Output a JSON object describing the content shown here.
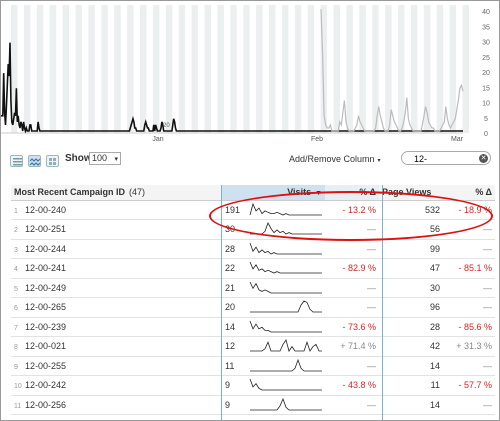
{
  "chart_data": {
    "type": "line",
    "x_labels": [
      "Jan",
      "Feb",
      "Mar"
    ],
    "y_ticks": [
      0,
      5,
      10,
      15,
      20,
      25,
      30,
      35,
      40
    ],
    "ylim": [
      0,
      42
    ],
    "inline_label": "20",
    "series": [
      {
        "color": "#111111",
        "values": [
          5,
          5,
          5,
          19,
          6,
          2,
          8,
          15,
          22,
          18,
          29,
          10,
          3,
          2,
          4,
          6,
          5,
          14,
          3,
          5,
          2,
          1,
          3,
          2,
          0,
          3,
          1,
          0,
          1,
          0,
          0,
          0,
          2,
          2,
          0,
          0,
          0,
          0,
          0,
          0,
          0,
          3,
          1,
          0,
          0,
          0,
          0,
          0,
          0,
          0,
          0,
          0,
          0,
          0,
          0,
          0,
          0,
          0,
          0,
          0,
          0,
          0,
          0,
          0,
          0,
          0,
          0,
          0,
          0,
          0,
          0,
          0,
          0,
          0,
          0,
          0,
          0,
          0,
          0,
          0,
          0,
          0,
          0,
          0,
          0,
          0,
          0,
          0,
          0,
          0,
          0,
          0,
          0,
          0,
          0,
          0,
          0,
          0,
          0,
          0,
          0,
          0,
          0,
          0,
          0,
          0,
          0,
          0,
          0,
          0,
          0,
          0,
          0,
          0,
          0,
          0,
          0,
          0,
          0,
          0,
          0,
          0,
          0,
          0,
          0,
          0,
          0,
          0,
          0,
          0,
          0,
          0,
          0,
          0,
          0,
          0,
          0,
          0,
          0,
          0,
          0,
          0,
          0,
          1,
          2,
          3,
          4,
          3,
          1,
          1,
          0,
          0,
          0,
          0,
          0,
          0,
          0,
          0,
          0,
          2,
          3,
          2,
          1,
          1,
          0,
          0,
          0,
          0,
          0,
          2,
          0,
          2,
          1,
          0,
          0,
          0,
          0,
          1,
          3,
          2,
          0,
          0,
          0,
          0,
          0,
          0,
          0,
          0,
          0,
          0,
          2,
          4,
          3,
          1,
          0,
          0,
          0,
          0,
          0,
          0,
          0,
          0,
          0,
          0,
          0,
          0,
          0,
          0,
          0,
          0,
          0,
          0,
          0,
          0,
          0,
          0,
          0,
          0,
          0,
          0,
          0,
          0,
          0,
          0,
          0,
          0,
          0,
          0,
          0,
          0,
          0,
          0,
          0,
          0,
          0,
          0,
          0,
          0,
          0,
          0,
          0,
          0,
          0,
          0,
          0,
          0,
          0,
          0,
          0,
          0,
          0,
          0,
          0,
          0,
          0,
          0,
          0,
          0,
          0,
          0,
          0,
          0,
          0,
          0,
          0,
          0,
          0,
          0,
          0,
          0,
          0,
          0,
          0,
          0,
          0,
          0,
          0,
          0,
          0,
          0,
          0,
          0,
          0,
          0,
          0,
          0,
          0,
          0,
          0,
          0,
          0,
          0,
          0,
          0,
          0,
          0,
          0,
          0,
          0,
          0,
          0,
          0,
          0,
          0,
          0,
          0,
          0,
          0,
          0,
          0,
          0,
          0,
          0,
          0,
          0,
          0,
          0,
          0,
          0,
          0,
          0,
          0,
          0,
          0,
          0,
          0,
          0,
          0,
          0,
          0,
          0,
          0,
          0,
          0,
          0,
          0,
          0,
          0,
          0,
          0,
          0,
          0,
          0,
          0,
          0,
          0,
          0,
          0,
          0,
          0,
          0,
          0,
          0,
          0,
          0,
          0,
          0,
          0,
          0,
          0,
          0,
          0,
          0,
          0,
          0,
          0,
          0,
          0,
          0,
          0,
          0,
          0,
          0,
          0,
          0,
          0,
          0,
          0,
          0,
          0,
          0,
          0,
          0,
          0,
          0,
          0,
          0,
          0,
          0,
          0,
          0,
          0,
          0,
          0,
          0,
          0,
          0,
          0,
          0,
          0,
          0,
          0,
          0,
          0,
          0,
          0,
          0,
          0,
          0,
          0,
          0,
          0,
          0,
          0,
          0,
          0,
          0,
          0,
          0,
          0,
          0,
          0,
          0,
          0,
          0,
          0,
          0,
          0,
          0,
          0,
          0,
          0,
          0,
          0,
          0,
          0,
          0,
          0,
          0,
          0,
          0,
          0,
          0,
          0,
          0,
          0,
          0,
          0,
          0,
          0,
          0,
          0,
          0,
          0,
          0,
          0,
          0,
          0,
          0,
          0,
          0,
          0,
          0,
          0,
          0,
          0,
          0,
          0,
          0,
          0,
          0,
          0,
          0,
          0,
          0,
          0,
          0,
          0,
          0,
          0,
          0,
          0,
          0,
          0,
          0,
          0,
          0,
          0,
          0,
          0,
          0,
          0,
          0,
          0,
          0,
          0,
          0,
          0,
          0,
          0,
          0,
          0,
          0,
          0,
          0,
          0,
          0,
          0,
          0,
          0,
          0,
          0
        ]
      },
      {
        "color": "#bbbbbb",
        "values": [
          40,
          25,
          5,
          2,
          1,
          1,
          2,
          0,
          0,
          0,
          0,
          0,
          3,
          2,
          6,
          10,
          3,
          1,
          0,
          0,
          0,
          0,
          1,
          2,
          5,
          3,
          2,
          1,
          0,
          0,
          0,
          0,
          0,
          0,
          0,
          1,
          5,
          8,
          5,
          3,
          1,
          0,
          0,
          0,
          2,
          7,
          5,
          3,
          2,
          1,
          0,
          0,
          1,
          3,
          6,
          11,
          4,
          2,
          1,
          0,
          0,
          0,
          0,
          0,
          0,
          2,
          5,
          8,
          6,
          3,
          2,
          1,
          1,
          0,
          0,
          0,
          0,
          1,
          2,
          3,
          8,
          4,
          2,
          1,
          2,
          3,
          4,
          7,
          10,
          14,
          15,
          13
        ]
      }
    ]
  },
  "toolbar": {
    "show_label": "Show",
    "show_value": "100",
    "add_remove_label": "Add/Remove Column",
    "search_value": "12-"
  },
  "table": {
    "headers": {
      "id": "Most Recent Campaign ID",
      "count": "(47)",
      "visits": "Visits",
      "visits_pct": "% Δ",
      "pageviews": "Page Views",
      "pv_pct": "% Δ"
    },
    "rows": [
      {
        "idx": "1",
        "id": "12-00-240",
        "visits": "191",
        "vpct": "- 13.2 %",
        "vpct_type": "neg",
        "pv": "532",
        "pvpct": "- 18.9 %",
        "pvpct_type": "neg",
        "spark": [
          0,
          8,
          3,
          5,
          1,
          3,
          2,
          1,
          1,
          2,
          1,
          0,
          1,
          0,
          0,
          0,
          0,
          0,
          0,
          0,
          0,
          0,
          0,
          0,
          0
        ]
      },
      {
        "idx": "2",
        "id": "12-00-251",
        "visits": "30",
        "vpct": "—",
        "vpct_type": "dash",
        "pv": "56",
        "pvpct": "—",
        "pvpct_type": "dash",
        "spark": [
          0,
          0,
          0,
          0,
          0,
          2,
          8,
          4,
          1,
          3,
          1,
          2,
          0,
          1,
          0,
          0,
          0,
          0,
          0,
          0,
          0,
          0,
          0,
          0,
          0
        ]
      },
      {
        "idx": "3",
        "id": "12-00-244",
        "visits": "28",
        "vpct": "—",
        "vpct_type": "dash",
        "pv": "99",
        "pvpct": "—",
        "pvpct_type": "dash",
        "spark": [
          8,
          2,
          5,
          1,
          3,
          1,
          2,
          0,
          1,
          0,
          0,
          0,
          0,
          0,
          0,
          0,
          0,
          0,
          0,
          0,
          0,
          0,
          0,
          0,
          0
        ]
      },
      {
        "idx": "4",
        "id": "12-00-241",
        "visits": "22",
        "vpct": "- 82.9 %",
        "vpct_type": "neg",
        "pv": "47",
        "pvpct": "- 85.1 %",
        "pvpct_type": "neg",
        "spark": [
          8,
          3,
          6,
          2,
          3,
          1,
          2,
          1,
          0,
          1,
          0,
          0,
          0,
          0,
          0,
          0,
          0,
          0,
          0,
          0,
          0,
          0,
          0,
          0,
          0
        ]
      },
      {
        "idx": "5",
        "id": "12-00-249",
        "visits": "21",
        "vpct": "—",
        "vpct_type": "dash",
        "pv": "30",
        "pvpct": "—",
        "pvpct_type": "dash",
        "spark": [
          7,
          3,
          6,
          2,
          1,
          2,
          1,
          0,
          0,
          0,
          0,
          0,
          0,
          0,
          0,
          0,
          0,
          0,
          0,
          0,
          0,
          0,
          0,
          0,
          0
        ]
      },
      {
        "idx": "6",
        "id": "12-00-265",
        "visits": "20",
        "vpct": "—",
        "vpct_type": "dash",
        "pv": "96",
        "pvpct": "—",
        "pvpct_type": "dash",
        "spark": [
          0,
          0,
          0,
          0,
          0,
          0,
          0,
          0,
          0,
          0,
          0,
          0,
          0,
          0,
          0,
          0,
          0,
          5,
          8,
          7,
          2,
          0,
          0,
          0,
          0
        ]
      },
      {
        "idx": "7",
        "id": "12-00-239",
        "visits": "14",
        "vpct": "- 73.6 %",
        "vpct_type": "neg",
        "pv": "28",
        "pvpct": "- 85.6 %",
        "pvpct_type": "neg",
        "spark": [
          7,
          2,
          5,
          2,
          3,
          1,
          1,
          0,
          0,
          0,
          0,
          0,
          0,
          0,
          0,
          0,
          0,
          0,
          0,
          0,
          0,
          0,
          0,
          0,
          0
        ]
      },
      {
        "idx": "8",
        "id": "12-00-021",
        "visits": "12",
        "vpct": "+ 71.4 %",
        "vpct_type": "pos",
        "pv": "42",
        "pvpct": "+ 31.3 %",
        "pvpct_type": "pos",
        "spark": [
          0,
          0,
          0,
          0,
          0,
          1,
          4,
          0,
          0,
          0,
          0,
          3,
          5,
          0,
          2,
          0,
          0,
          0,
          0,
          4,
          0,
          2,
          3,
          0,
          0
        ]
      },
      {
        "idx": "9",
        "id": "12-00-255",
        "visits": "11",
        "vpct": "—",
        "vpct_type": "dash",
        "pv": "14",
        "pvpct": "—",
        "pvpct_type": "dash",
        "spark": [
          0,
          0,
          0,
          0,
          0,
          0,
          0,
          0,
          0,
          0,
          0,
          0,
          0,
          0,
          0,
          2,
          8,
          2,
          0,
          0,
          0,
          0,
          0,
          0,
          0
        ]
      },
      {
        "idx": "10",
        "id": "12-00-242",
        "visits": "9",
        "vpct": "- 43.8 %",
        "vpct_type": "neg",
        "pv": "11",
        "pvpct": "- 57.7 %",
        "pvpct_type": "neg",
        "spark": [
          7,
          2,
          4,
          1,
          0,
          0,
          0,
          0,
          0,
          0,
          0,
          0,
          0,
          0,
          0,
          0,
          0,
          0,
          0,
          0,
          0,
          0,
          0,
          0,
          0
        ]
      },
      {
        "idx": "11",
        "id": "12-00-256",
        "visits": "9",
        "vpct": "—",
        "vpct_type": "dash",
        "pv": "14",
        "pvpct": "—",
        "pvpct_type": "dash",
        "spark": [
          0,
          0,
          0,
          0,
          0,
          0,
          0,
          0,
          0,
          0,
          3,
          8,
          2,
          0,
          0,
          0,
          0,
          0,
          0,
          0,
          0,
          0,
          0,
          0,
          0
        ]
      }
    ]
  }
}
